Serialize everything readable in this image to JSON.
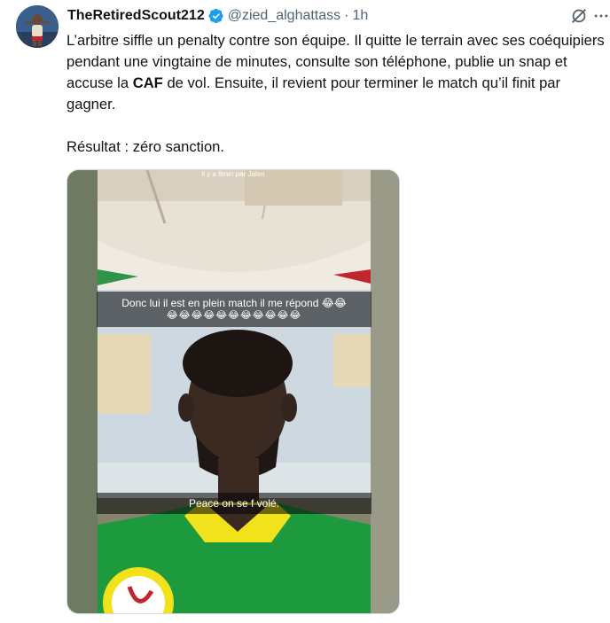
{
  "tweet": {
    "display_name": "TheRetiredScout212",
    "handle": "@zied_alghattass",
    "separator": "·",
    "time": "1h",
    "text_line_1_part1": "L’arbitre siffle un penalty contre son équipe. Il quitte le terrain avec ses coéquipiers pendant une vingtaine de minutes, consulte son téléphone, publie un snap et accuse la ",
    "text_line_1_bold": "CAF",
    "text_line_1_part2": " de vol. Ensuite, il revient pour terminer le match qu’il finit par gagner.",
    "text_line_2": "Résultat : zéro sanction."
  },
  "media": {
    "snap_header": "il y a 8min par Jalen",
    "caption_top": "Donc lui il est en plein match il me répond 😂😂",
    "caption_top_emojis": "😂😂😂😂😂😂😂😂😂😂😂",
    "caption_bottom": "Peace on se f volé."
  },
  "icons": {
    "verified": "verified-badge-icon",
    "grok": "grok-icon",
    "more": "more-options-icon"
  },
  "colors": {
    "verified": "#1d9bf0",
    "secondary_text": "#536471",
    "jersey_green": "#1e9a3e",
    "jersey_yellow": "#f2e21b"
  }
}
